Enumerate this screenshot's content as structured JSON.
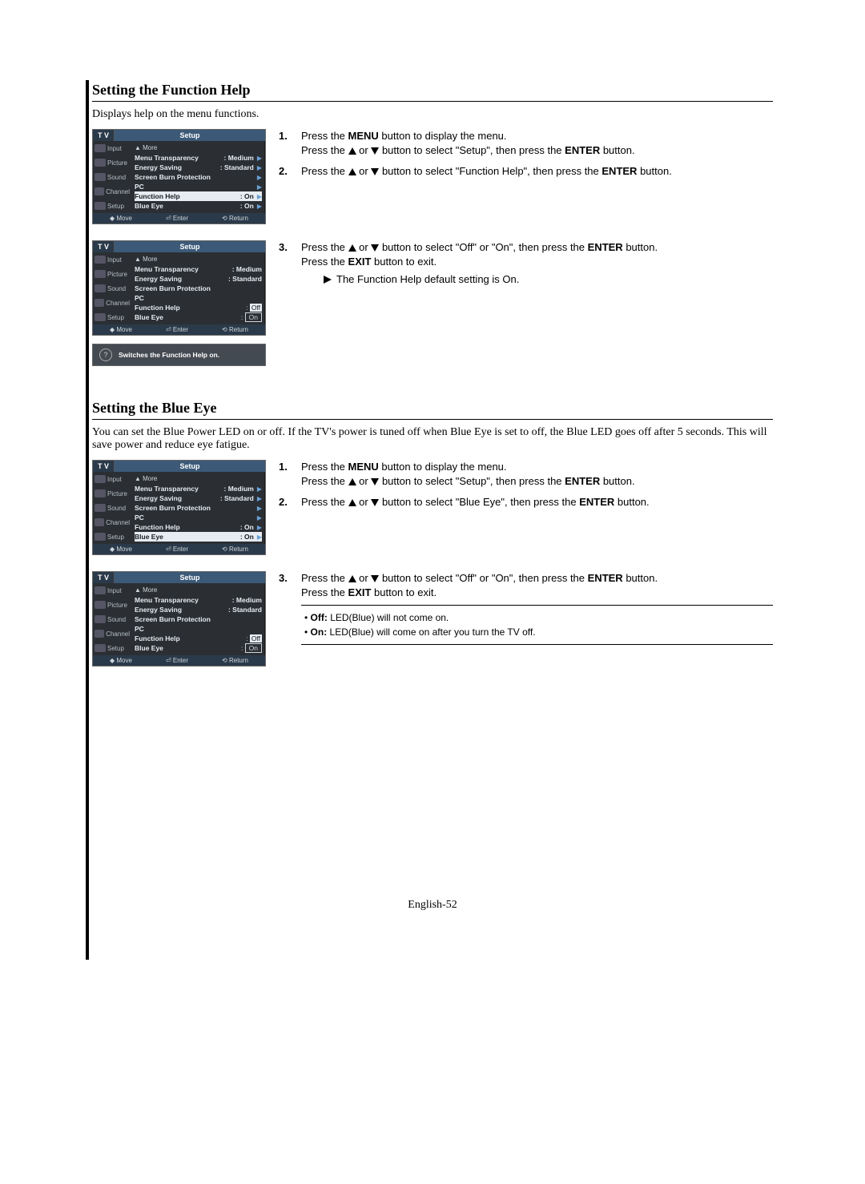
{
  "section1": {
    "title": "Setting the Function Help",
    "intro": "Displays help on the menu functions.",
    "steps": [
      {
        "num": "1.",
        "text_a": "Press the ",
        "b1": "MENU",
        "text_b": " button to display the menu.",
        "line2_a": "Press the ",
        "line2_b": " or ",
        "line2_c": " button to select \"Setup\", then press the ",
        "b2": "ENTER",
        "line2_d": " button."
      },
      {
        "num": "2.",
        "text_a": "Press the ",
        "text_b": " or ",
        "text_c": " button to select \"Function Help\", then press the ",
        "b1": "ENTER",
        "text_d": " button."
      },
      {
        "num": "3.",
        "text_a": "Press the ",
        "text_b": " or ",
        "text_c": " button to select \"Off\" or \"On\", then press the ",
        "b1": "ENTER",
        "text_d": " button.",
        "line2": "Press the ",
        "b2": "EXIT",
        "line2_d": " button to exit.",
        "note": "The Function Help default setting is On."
      }
    ]
  },
  "section2": {
    "title": "Setting the Blue Eye",
    "intro": "You can set the Blue Power LED on or off. If the TV's power is tuned off when Blue Eye is set to off, the Blue LED goes off after 5 seconds. This will save power and reduce eye fatigue.",
    "steps": [
      {
        "num": "1.",
        "text_a": "Press the ",
        "b1": "MENU",
        "text_b": " button to display the menu.",
        "line2_a": "Press the ",
        "line2_b": " or ",
        "line2_c": " button to select \"Setup\", then press the ",
        "b2": "ENTER",
        "line2_d": " button."
      },
      {
        "num": "2.",
        "text_a": "Press the ",
        "text_b": " or ",
        "text_c": " button to select \"Blue Eye\", then press the ",
        "b1": "ENTER",
        "text_d": " button."
      },
      {
        "num": "3.",
        "text_a": "Press the ",
        "text_b": " or ",
        "text_c": " button to select \"Off\" or \"On\", then press the ",
        "b1": "ENTER",
        "text_d": " button.",
        "line2": "Press the ",
        "b2": "EXIT",
        "line2_d": " button to exit."
      }
    ],
    "def_off_label": "Off:",
    "def_off": " LED(Blue) will not come on.",
    "def_on_label": "On:",
    "def_on": " LED(Blue) will come on after you turn the TV off."
  },
  "osd": {
    "tv": "T V",
    "title": "Setup",
    "nav": [
      "Input",
      "Picture",
      "Sound",
      "Channel",
      "Setup"
    ],
    "more": "▲ More",
    "rows": {
      "menu_trans": "Menu Transparency",
      "menu_trans_v": ": Medium",
      "energy": "Energy Saving",
      "energy_v": ": Standard",
      "sbp": "Screen Burn Protection",
      "pc": "PC",
      "fh": "Function Help",
      "fh_v": ": On",
      "be": "Blue Eye",
      "be_v": ": On",
      "off": "Off",
      "on": "On"
    },
    "foot_move": "Move",
    "foot_enter": "Enter",
    "foot_return": "Return",
    "help_tip": "Switches the Function Help on."
  },
  "page_number": "English-52"
}
